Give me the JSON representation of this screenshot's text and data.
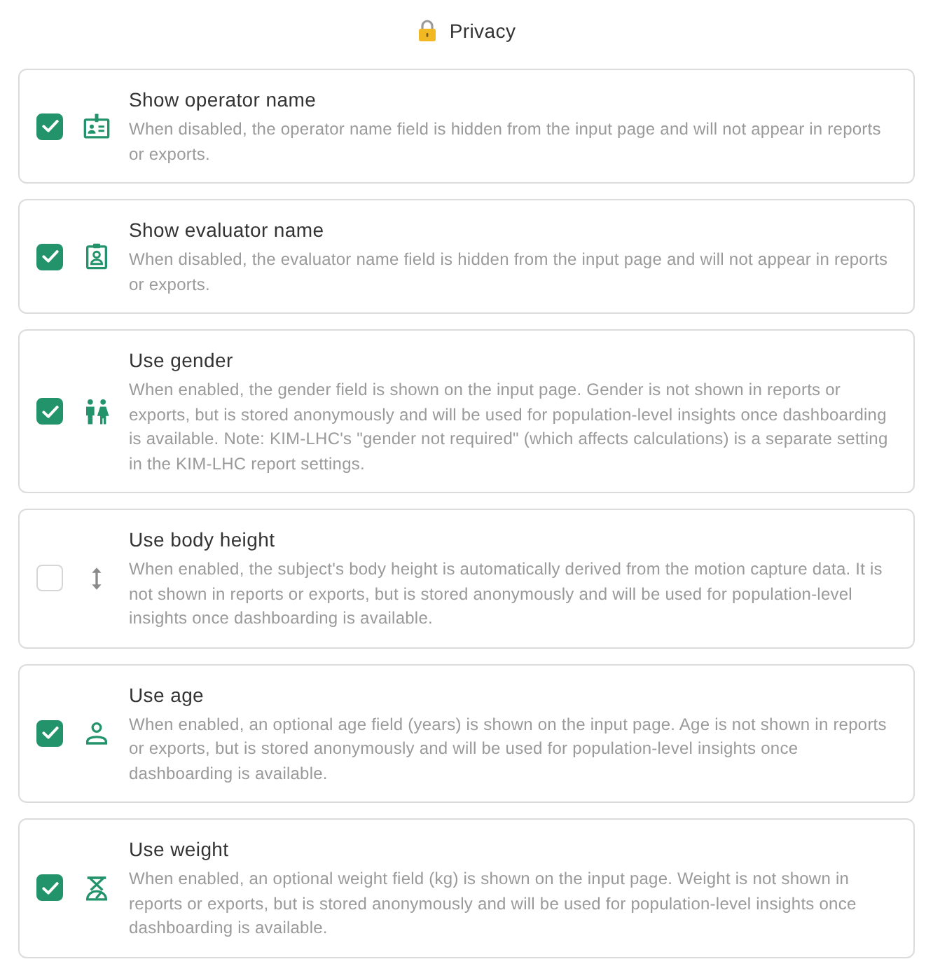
{
  "header": {
    "title": "Privacy"
  },
  "settings": [
    {
      "title": "Show operator name",
      "description": "When disabled, the operator name field is hidden from the input page and will not appear in reports or exports.",
      "checked": true
    },
    {
      "title": "Show evaluator name",
      "description": "When disabled, the evaluator name field is hidden from the input page and will not appear in reports or exports.",
      "checked": true
    },
    {
      "title": "Use gender",
      "description": "When enabled, the gender field is shown on the input page. Gender is not shown in reports or exports, but is stored anonymously and will be used for population-level insights once dashboarding is available. Note: KIM-LHC's \"gender not required\" (which affects calculations) is a separate setting in the KIM-LHC report settings.",
      "checked": true
    },
    {
      "title": "Use body height",
      "description": "When enabled, the subject's body height is automatically derived from the motion capture data. It is not shown in reports or exports, but is stored anonymously and will be used for population-level insights once dashboarding is available.",
      "checked": false
    },
    {
      "title": "Use age",
      "description": "When enabled, an optional age field (years) is shown on the input page. Age is not shown in reports or exports, but is stored anonymously and will be used for population-level insights once dashboarding is available.",
      "checked": true
    },
    {
      "title": "Use weight",
      "description": "When enabled, an optional weight field (kg) is shown on the input page. Weight is not shown in reports or exports, but is stored anonymously and will be used for population-level insights once dashboarding is available.",
      "checked": true
    }
  ]
}
